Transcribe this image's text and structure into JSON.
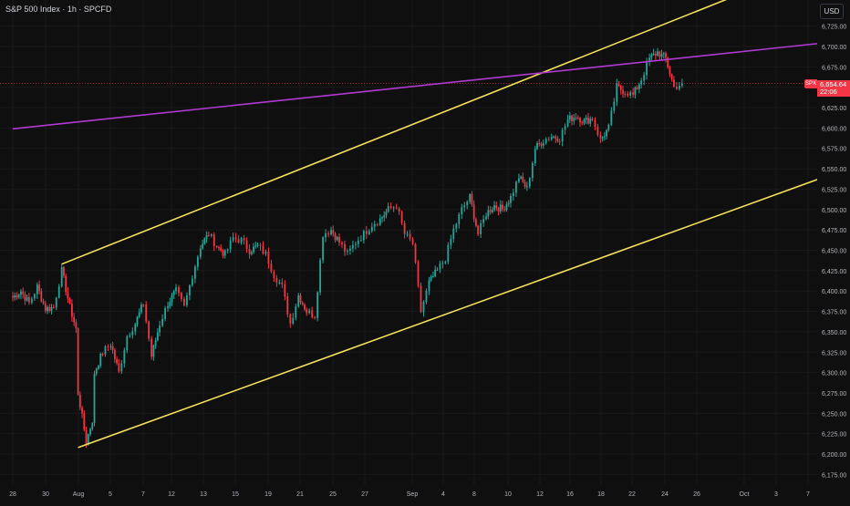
{
  "legend": {
    "title": "S&P 500 Index · 1h · SPCFD"
  },
  "currency_button": "USD",
  "last_price": {
    "symbol": "SPX",
    "value": "6,654.64",
    "countdown": "22:06",
    "color": "#f23645"
  },
  "colors": {
    "background": "#0f0f0f",
    "up": "#26a69a",
    "down": "#f23645",
    "channel": "#f5e05a",
    "purple_line": "#b03ad2",
    "grid": "#1a1a1a",
    "axis_text": "#b2b5be"
  },
  "chart_data": {
    "type": "candlestick",
    "title": "S&P 500 Index · 1h · SPCFD",
    "xlabel": "",
    "ylabel": "",
    "ylim": [
      6162,
      6757
    ],
    "y_ticks": [
      "6,175.00",
      "6,200.00",
      "6,225.00",
      "6,250.00",
      "6,275.00",
      "6,300.00",
      "6,325.00",
      "6,350.00",
      "6,375.00",
      "6,400.00",
      "6,425.00",
      "6,450.00",
      "6,475.00",
      "6,500.00",
      "6,525.00",
      "6,550.00",
      "6,575.00",
      "6,600.00",
      "6,625.00",
      "6,650.00",
      "6,675.00",
      "6,700.00",
      "6,725.00"
    ],
    "x_ticks": [
      "28",
      "30",
      "Aug",
      "5",
      "7",
      "12",
      "13",
      "15",
      "19",
      "21",
      "25",
      "27",
      "Sep",
      "4",
      "8",
      "10",
      "12",
      "16",
      "18",
      "22",
      "24",
      "26",
      "Oct",
      "3",
      "7"
    ],
    "grid": true,
    "last_value": 6654.64,
    "trendlines": [
      {
        "name": "channel-upper",
        "from": {
          "x": "Jul 31",
          "y": 6433
        },
        "to": {
          "x": "Sep 29",
          "y": 6760
        },
        "color": "#f5e05a"
      },
      {
        "name": "channel-lower",
        "from": {
          "x": "Aug 1",
          "y": 6208
        },
        "to": {
          "x": "Oct 7",
          "y": 6542
        },
        "color": "#f5e05a"
      },
      {
        "name": "purple-line",
        "from": {
          "x": "Jul 28",
          "y": 6599
        },
        "to": {
          "x": "Oct 7",
          "y": 6705
        },
        "color": "#b03ad2"
      }
    ],
    "series": [
      {
        "name": "SPX",
        "anchors": [
          {
            "x": "Jul 28",
            "close": 6392
          },
          {
            "x": "Jul 28",
            "close": 6400
          },
          {
            "x": "Jul 29",
            "close": 6385
          },
          {
            "x": "Jul 29",
            "close": 6405
          },
          {
            "x": "Jul 30",
            "close": 6378
          },
          {
            "x": "Jul 30",
            "close": 6380
          },
          {
            "x": "Jul 31",
            "close": 6425
          },
          {
            "x": "Jul 31",
            "close": 6380
          },
          {
            "x": "Jul 31",
            "close": 6345
          },
          {
            "x": "Aug 1",
            "close": 6275
          },
          {
            "x": "Aug 1",
            "close": 6215
          },
          {
            "x": "Aug 1",
            "close": 6250
          },
          {
            "x": "Aug 4",
            "close": 6300
          },
          {
            "x": "Aug 4",
            "close": 6325
          },
          {
            "x": "Aug 5",
            "close": 6335
          },
          {
            "x": "Aug 5",
            "close": 6300
          },
          {
            "x": "Aug 6",
            "close": 6345
          },
          {
            "x": "Aug 6",
            "close": 6360
          },
          {
            "x": "Aug 7",
            "close": 6385
          },
          {
            "x": "Aug 7",
            "close": 6320
          },
          {
            "x": "Aug 8",
            "close": 6360
          },
          {
            "x": "Aug 8",
            "close": 6385
          },
          {
            "x": "Aug 11",
            "close": 6400
          },
          {
            "x": "Aug 11",
            "close": 6380
          },
          {
            "x": "Aug 12",
            "close": 6420
          },
          {
            "x": "Aug 12",
            "close": 6455
          },
          {
            "x": "Aug 13",
            "close": 6470
          },
          {
            "x": "Aug 13",
            "close": 6455
          },
          {
            "x": "Aug 14",
            "close": 6445
          },
          {
            "x": "Aug 14",
            "close": 6465
          },
          {
            "x": "Aug 15",
            "close": 6462
          },
          {
            "x": "Aug 15",
            "close": 6450
          },
          {
            "x": "Aug 18",
            "close": 6455
          },
          {
            "x": "Aug 18",
            "close": 6445
          },
          {
            "x": "Aug 19",
            "close": 6420
          },
          {
            "x": "Aug 19",
            "close": 6405
          },
          {
            "x": "Aug 20",
            "close": 6360
          },
          {
            "x": "Aug 20",
            "close": 6395
          },
          {
            "x": "Aug 21",
            "close": 6375
          },
          {
            "x": "Aug 21",
            "close": 6370
          },
          {
            "x": "Aug 22",
            "close": 6470
          },
          {
            "x": "Aug 22",
            "close": 6475
          },
          {
            "x": "Aug 25",
            "close": 6460
          },
          {
            "x": "Aug 25",
            "close": 6445
          },
          {
            "x": "Aug 26",
            "close": 6460
          },
          {
            "x": "Aug 26",
            "close": 6470
          },
          {
            "x": "Aug 27",
            "close": 6482
          },
          {
            "x": "Aug 27",
            "close": 6488
          },
          {
            "x": "Aug 28",
            "close": 6500
          },
          {
            "x": "Aug 28",
            "close": 6505
          },
          {
            "x": "Aug 29",
            "close": 6470
          },
          {
            "x": "Aug 29",
            "close": 6458
          },
          {
            "x": "Sep 2",
            "close": 6375
          },
          {
            "x": "Sep 2",
            "close": 6410
          },
          {
            "x": "Sep 3",
            "close": 6425
          },
          {
            "x": "Sep 3",
            "close": 6440
          },
          {
            "x": "Sep 4",
            "close": 6475
          },
          {
            "x": "Sep 4",
            "close": 6500
          },
          {
            "x": "Sep 5",
            "close": 6515
          },
          {
            "x": "Sep 5",
            "close": 6470
          },
          {
            "x": "Sep 8",
            "close": 6495
          },
          {
            "x": "Sep 8",
            "close": 6505
          },
          {
            "x": "Sep 9",
            "close": 6500
          },
          {
            "x": "Sep 9",
            "close": 6515
          },
          {
            "x": "Sep 10",
            "close": 6540
          },
          {
            "x": "Sep 10",
            "close": 6525
          },
          {
            "x": "Sep 11",
            "close": 6575
          },
          {
            "x": "Sep 11",
            "close": 6585
          },
          {
            "x": "Sep 12",
            "close": 6590
          },
          {
            "x": "Sep 12",
            "close": 6588
          },
          {
            "x": "Sep 15",
            "close": 6610
          },
          {
            "x": "Sep 15",
            "close": 6615
          },
          {
            "x": "Sep 16",
            "close": 6608
          },
          {
            "x": "Sep 16",
            "close": 6612
          },
          {
            "x": "Sep 17",
            "close": 6585
          },
          {
            "x": "Sep 17",
            "close": 6600
          },
          {
            "x": "Sep 18",
            "close": 6650
          },
          {
            "x": "Sep 18",
            "close": 6645
          },
          {
            "x": "Sep 19",
            "close": 6640
          },
          {
            "x": "Sep 19",
            "close": 6660
          },
          {
            "x": "Sep 22",
            "close": 6685
          },
          {
            "x": "Sep 22",
            "close": 6693
          },
          {
            "x": "Sep 23",
            "close": 6685
          },
          {
            "x": "Sep 23",
            "close": 6650
          },
          {
            "x": "Sep 24",
            "close": 6654.64
          }
        ]
      }
    ]
  }
}
